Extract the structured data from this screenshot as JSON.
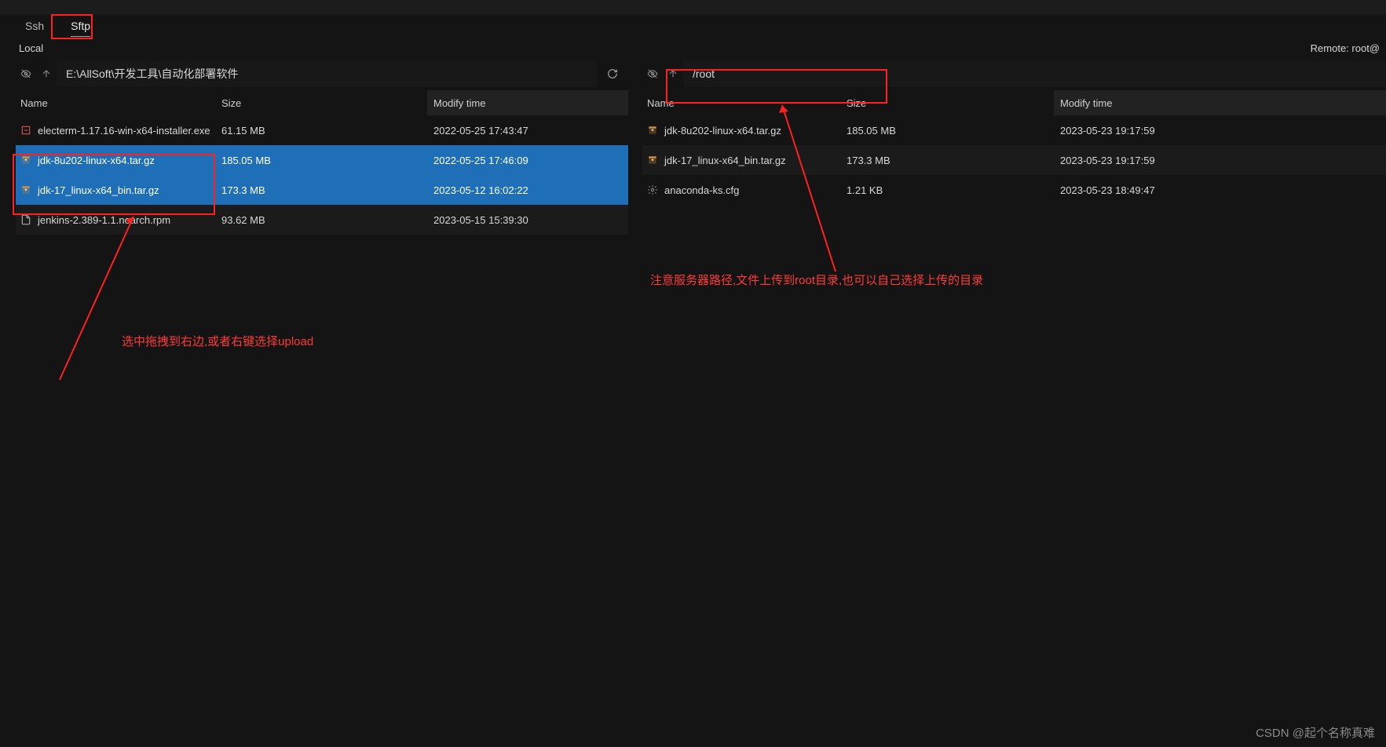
{
  "tabs": {
    "ssh": "Ssh",
    "sftp": "Sftp"
  },
  "labels": {
    "local": "Local",
    "remote": "Remote: root@"
  },
  "local": {
    "path": "E:\\AllSoft\\开发工具\\自动化部署软件",
    "columns": {
      "name": "Name",
      "size": "Size",
      "time": "Modify time"
    },
    "files": [
      {
        "name": "electerm-1.17.16-win-x64-installer.exe",
        "size": "61.15 MB",
        "time": "2022-05-25 17:43:47",
        "icon": "exe",
        "selected": false,
        "alt": false
      },
      {
        "name": "jdk-8u202-linux-x64.tar.gz",
        "size": "185.05 MB",
        "time": "2022-05-25 17:46:09",
        "icon": "archive",
        "selected": true,
        "alt": false
      },
      {
        "name": "jdk-17_linux-x64_bin.tar.gz",
        "size": "173.3 MB",
        "time": "2023-05-12 16:02:22",
        "icon": "archive",
        "selected": true,
        "alt": false
      },
      {
        "name": "jenkins-2.389-1.1.noarch.rpm",
        "size": "93.62 MB",
        "time": "2023-05-15 15:39:30",
        "icon": "file",
        "selected": false,
        "alt": true
      }
    ]
  },
  "remote": {
    "path": "/root",
    "columns": {
      "name": "Name",
      "size": "Size",
      "time": "Modify time"
    },
    "files": [
      {
        "name": "jdk-8u202-linux-x64.tar.gz",
        "size": "185.05 MB",
        "time": "2023-05-23 19:17:59",
        "icon": "archive",
        "selected": false,
        "alt": false
      },
      {
        "name": "jdk-17_linux-x64_bin.tar.gz",
        "size": "173.3 MB",
        "time": "2023-05-23 19:17:59",
        "icon": "archive",
        "selected": false,
        "alt": true
      },
      {
        "name": "anaconda-ks.cfg",
        "size": "1.21 KB",
        "time": "2023-05-23 18:49:47",
        "icon": "cfg",
        "selected": false,
        "alt": false
      }
    ]
  },
  "annotations": {
    "left": "选中拖拽到右边,或者右键选择upload",
    "right": "注意服务器路径,文件上传到root目录,也可以自己选择上传的目录"
  },
  "watermark": "CSDN @起个名称真难"
}
